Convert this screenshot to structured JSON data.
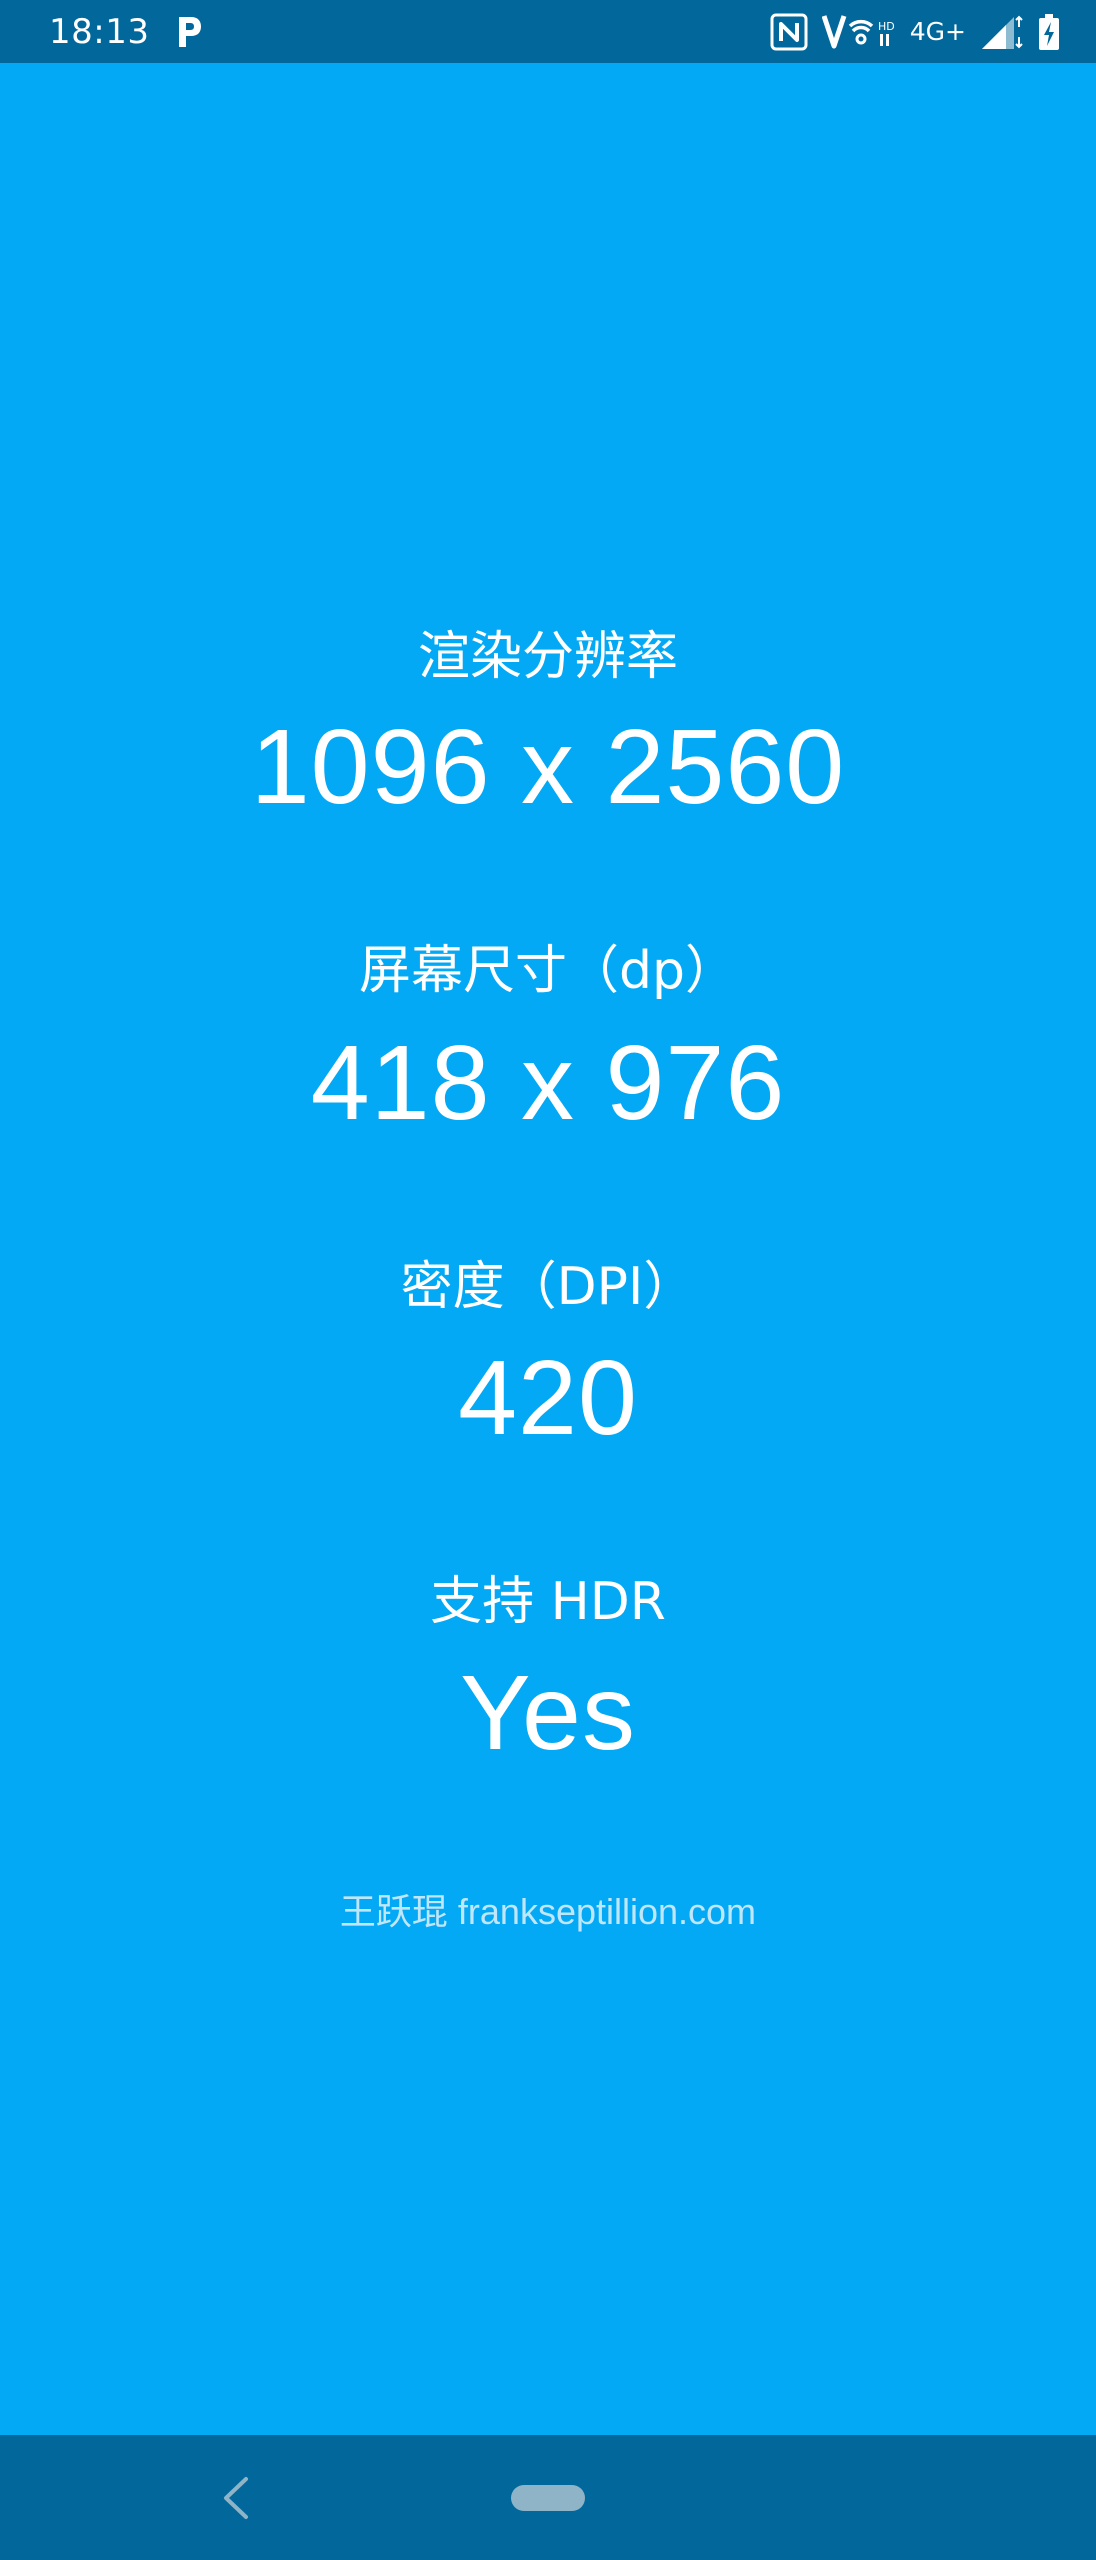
{
  "status_bar": {
    "time": "18:13",
    "left_icon": "p-notification-icon",
    "icons": [
      "nfc-icon",
      "volte-wifi-icon",
      "signal-icon",
      "battery-charging-icon"
    ],
    "network_label": "4G+"
  },
  "screen_info": {
    "render_resolution": {
      "label": "渲染分辨率",
      "value": "1096 x 2560"
    },
    "screen_size_dp": {
      "label": "屏幕尺寸（dp）",
      "value": "418 x 976"
    },
    "density_dpi": {
      "label": "密度（DPI）",
      "value": "420"
    },
    "hdr_support": {
      "label": "支持 HDR",
      "value": "Yes"
    }
  },
  "footer": {
    "credit": "王跃琨 frankseptillion.com"
  },
  "nav_bar": {
    "buttons": [
      "back-icon",
      "home-pill"
    ]
  },
  "colors": {
    "background": "#03a9f4",
    "bars": "#02689b",
    "text": "#ffffff",
    "footer_text": "#bfe6fb"
  }
}
